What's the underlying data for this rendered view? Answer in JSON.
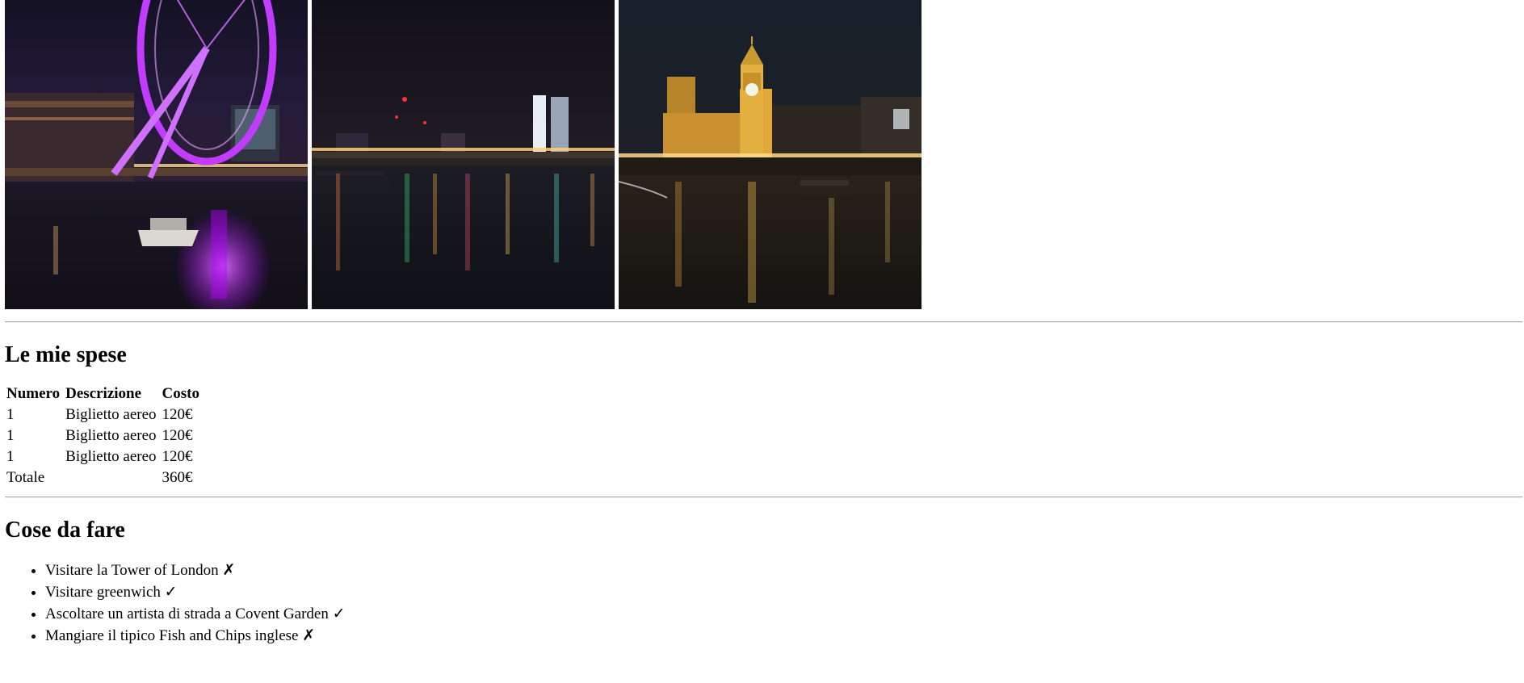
{
  "photos": [
    {
      "name": "London Eye at night",
      "alt": "London Eye di notte"
    },
    {
      "name": "Thames skyline at night",
      "alt": "Tamigi di notte"
    },
    {
      "name": "Big Ben and Westminster at night",
      "alt": "Big Ben di notte"
    }
  ],
  "expenses": {
    "title": "Le mie spese",
    "headers": {
      "number": "Numero",
      "description": "Descrizione",
      "cost": "Costo"
    },
    "rows": [
      {
        "number": "1",
        "description": "Biglietto aereo",
        "cost": "120€"
      },
      {
        "number": "1",
        "description": "Biglietto aereo",
        "cost": "120€"
      },
      {
        "number": "1",
        "description": "Biglietto aereo",
        "cost": "120€"
      }
    ],
    "total": {
      "label": "Totale",
      "cost": "360€"
    }
  },
  "todo": {
    "title": "Cose da fare",
    "items": [
      {
        "text": "Visitare la Tower of London ✗"
      },
      {
        "text": "Visitare greenwich ✓"
      },
      {
        "text": "Ascoltare un artista di strada a Covent Garden ✓"
      },
      {
        "text": "Mangiare il tipico Fish and Chips inglese ✗"
      }
    ]
  },
  "colors": {
    "eye_magenta": "#c23cff",
    "night_sky": "#15131f",
    "city_lights": "#ffb347",
    "rule": "#a9a9a9"
  }
}
